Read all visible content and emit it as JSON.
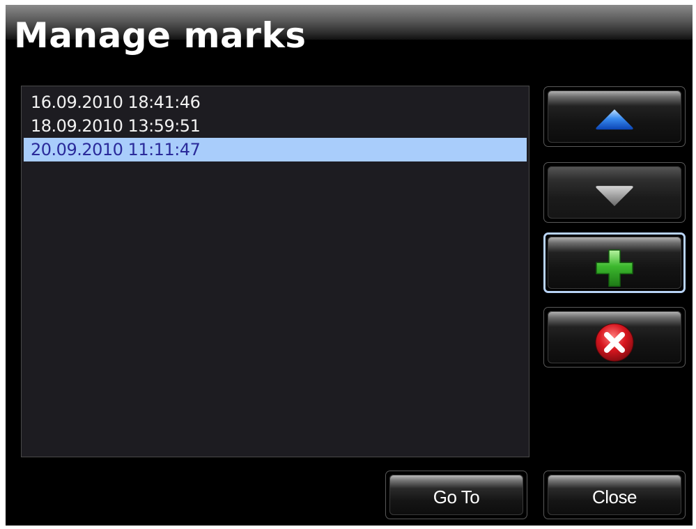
{
  "dialog": {
    "title": "Manage marks"
  },
  "marks": {
    "items": [
      {
        "label": "16.09.2010 18:41:46",
        "selected": false
      },
      {
        "label": "18.09.2010 13:59:51",
        "selected": false
      },
      {
        "label": "20.09.2010 11:11:47",
        "selected": true
      }
    ]
  },
  "side_buttons": [
    {
      "name": "move-up-button",
      "icon": "arrow-up-icon",
      "enabled": true,
      "focused": false
    },
    {
      "name": "move-down-button",
      "icon": "arrow-down-icon",
      "enabled": false,
      "focused": false
    },
    {
      "name": "add-mark-button",
      "icon": "plus-icon",
      "enabled": true,
      "focused": true
    },
    {
      "name": "delete-mark-button",
      "icon": "delete-icon",
      "enabled": true,
      "focused": false
    }
  ],
  "footer": {
    "goto_label": "Go To",
    "close_label": "Close"
  },
  "colors": {
    "selection": "#a9cdfb",
    "selection_text": "#2a2a9a",
    "list_bg": "#1d1c21",
    "up_arrow": "#2f7fe8",
    "down_arrow": "#8a8a8a",
    "plus": "#3cb82e",
    "delete": "#d8161f"
  }
}
